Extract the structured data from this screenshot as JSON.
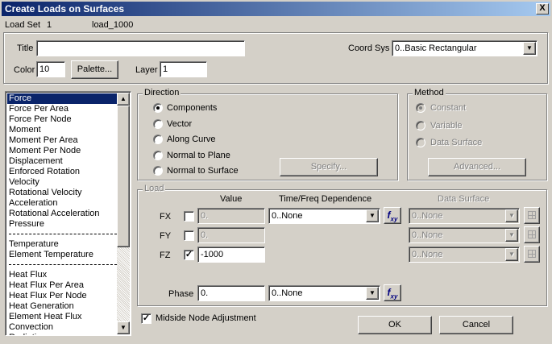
{
  "window": {
    "title": "Create Loads on Surfaces",
    "close_glyph": "X"
  },
  "header": {
    "load_set_label": "Load Set",
    "load_set_id": "1",
    "load_set_name": "load_1000"
  },
  "form": {
    "title_label": "Title",
    "title_value": "",
    "coord_sys_label": "Coord Sys",
    "coord_sys_value": "0..Basic Rectangular",
    "color_label": "Color",
    "color_value": "10",
    "palette_button": "Palette...",
    "layer_label": "Layer",
    "layer_value": "1"
  },
  "load_types": [
    "Force",
    "Force Per Area",
    "Force Per Node",
    "Moment",
    "Moment Per Area",
    "Moment Per Node",
    "Displacement",
    "Enforced Rotation",
    "Velocity",
    "Rotational Velocity",
    "Acceleration",
    "Rotational Acceleration",
    "Pressure",
    "Temperature",
    "Element Temperature",
    "Heat Flux",
    "Heat Flux Per Area",
    "Heat Flux Per Node",
    "Heat Generation",
    "Element Heat Flux",
    "Convection",
    "Radiation"
  ],
  "selected_load_type": "Force",
  "direction": {
    "label": "Direction",
    "options": [
      "Components",
      "Vector",
      "Along Curve",
      "Normal to Plane",
      "Normal to Surface"
    ],
    "selected": "Components",
    "specify_button": "Specify..."
  },
  "method": {
    "label": "Method",
    "options": [
      "Constant",
      "Variable",
      "Data Surface"
    ],
    "selected": "Constant",
    "advanced_button": "Advanced..."
  },
  "load": {
    "label": "Load",
    "col_value": "Value",
    "col_time": "Time/Freq Dependence",
    "col_surface": "Data Surface",
    "rows": [
      {
        "label": "FX",
        "checked": false,
        "check_glyph": "",
        "value": "0.",
        "time": "0..None",
        "surface": "0..None"
      },
      {
        "label": "FY",
        "checked": false,
        "check_glyph": "",
        "value": "0.",
        "time": "",
        "surface": "0..None"
      },
      {
        "label": "FZ",
        "checked": true,
        "check_glyph": "✓",
        "value": "-1000",
        "time": "",
        "surface": "0..None"
      }
    ],
    "phase_label": "Phase",
    "phase_value": "0.",
    "phase_time": "0..None"
  },
  "fxy": {
    "f": "f",
    "sub": "xy"
  },
  "midside": {
    "label": "Midside Node Adjustment",
    "checked": true,
    "glyph": "✓"
  },
  "buttons": {
    "ok": "OK",
    "cancel": "Cancel"
  },
  "glyphs": {
    "down": "▼",
    "up": "▲"
  }
}
